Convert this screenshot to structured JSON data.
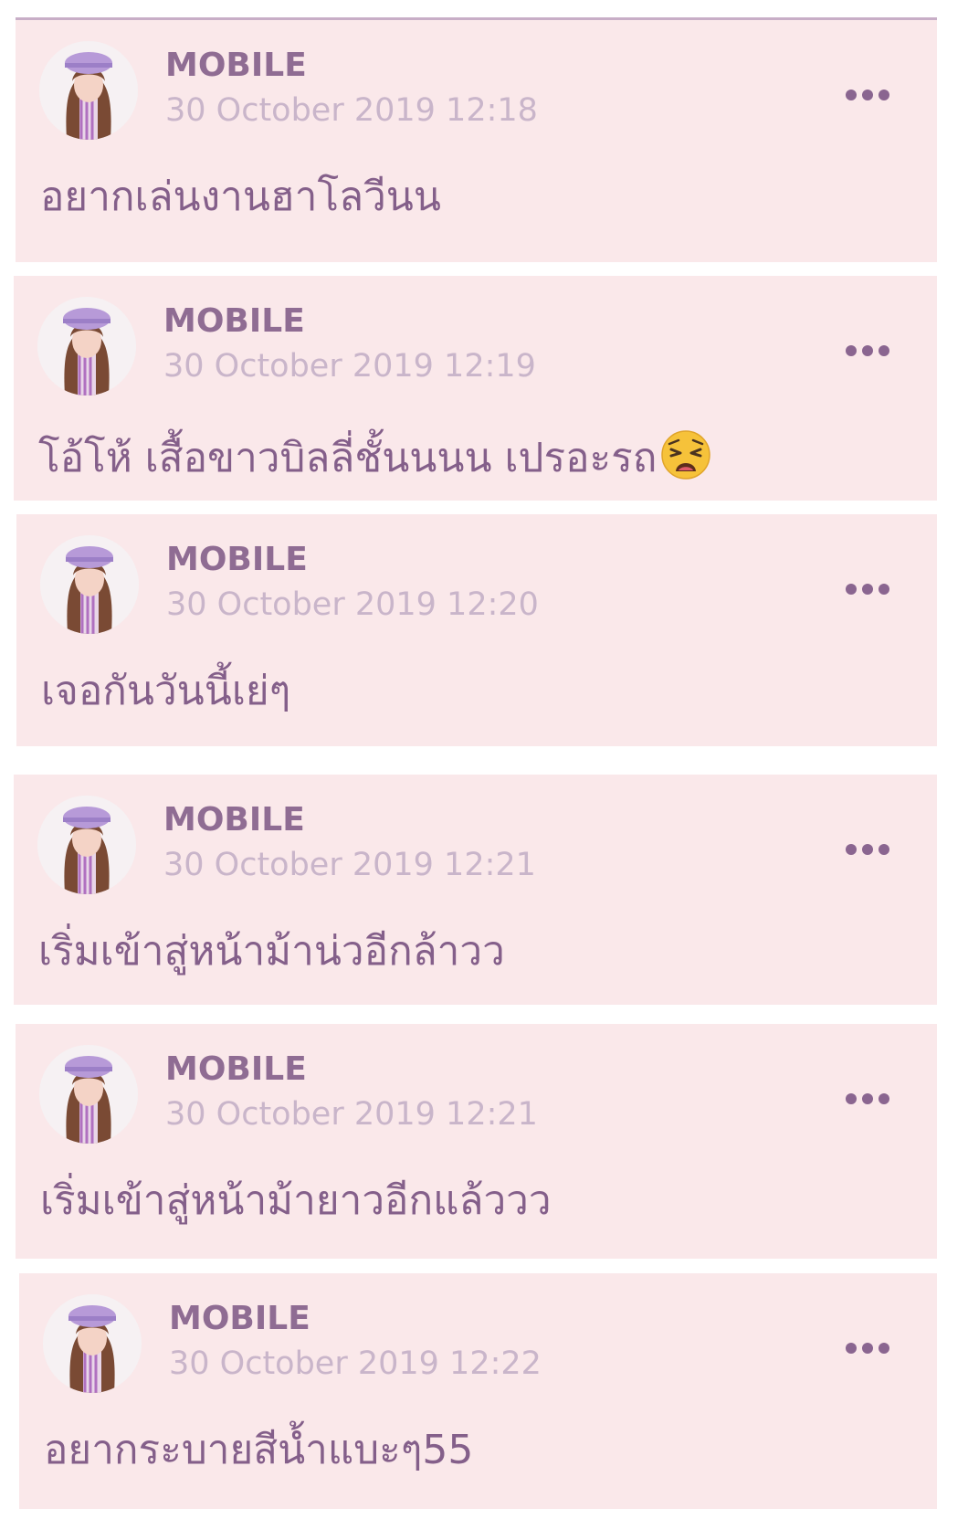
{
  "posts": [
    {
      "name": "MOBILE",
      "time": "30 October 2019 12:18",
      "text": "อยากเล่นงานฮาโลวีนน",
      "emoji": ""
    },
    {
      "name": "MOBILE",
      "time": "30 October 2019 12:19",
      "text": "โอ้โห้ เสื้อขาวบิลลี่ชั้นนนน เปรอะรถ",
      "emoji": "weary-face-emoji"
    },
    {
      "name": "MOBILE",
      "time": "30 October 2019 12:20",
      "text": "เจอกันวันนี้เย่ๆ",
      "emoji": ""
    },
    {
      "name": "MOBILE",
      "time": "30 October 2019 12:21",
      "text": "เริ่มเข้าสู่หน้าม้าน่วอีกล้าวว",
      "emoji": ""
    },
    {
      "name": "MOBILE",
      "time": "30 October 2019 12:21",
      "text": "เริ่มเข้าสู่หน้าม้ายาวอีกแล้ววว",
      "emoji": ""
    },
    {
      "name": "MOBILE",
      "time": "30 October 2019 12:22",
      "text": "อยากระบายสีน้ำแบะๆ55",
      "emoji": ""
    }
  ],
  "icons": {
    "more": "more-horizontal-icon",
    "avatar": "profile-avatar-photo"
  },
  "colors": {
    "card_background": "#fae8ea",
    "name": "#8f6c93",
    "timestamp": "#c9b5ca",
    "message": "#845f8a"
  }
}
